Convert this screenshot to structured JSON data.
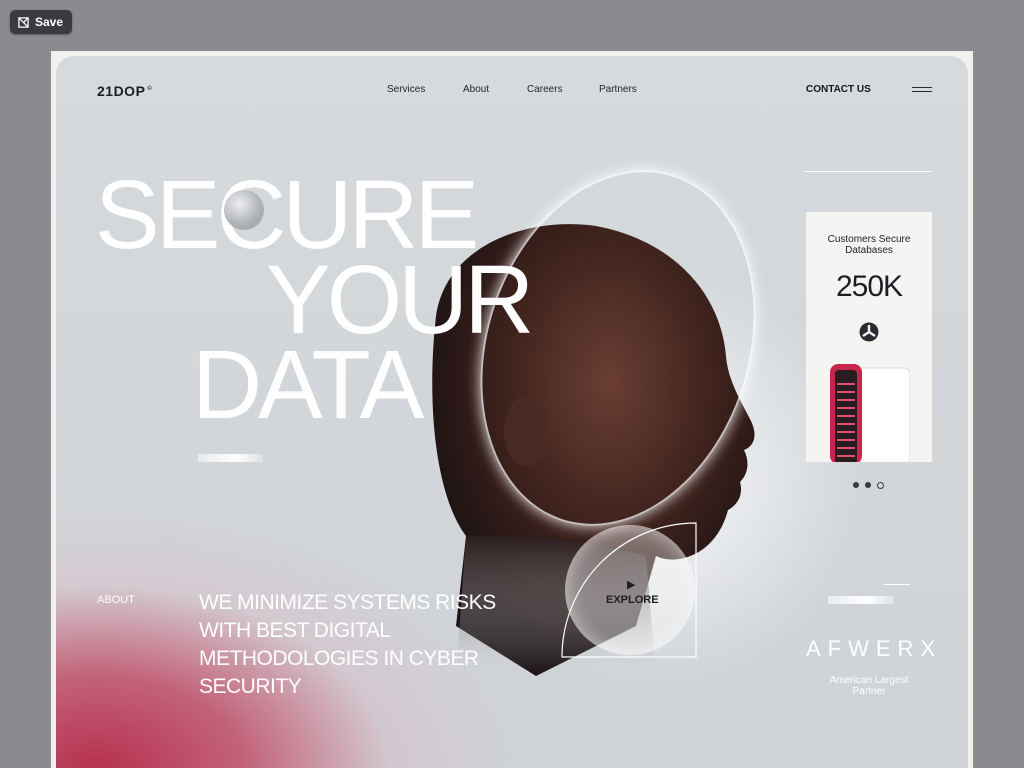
{
  "toolbar": {
    "save_label": "Save"
  },
  "header": {
    "logo": "21DOP",
    "logo_mark": "©",
    "nav": [
      "Services",
      "About",
      "Careers",
      "Partners"
    ],
    "contact": "CONTACT US"
  },
  "hero": {
    "title_lines": [
      "SECURE",
      "YOUR",
      "DATA"
    ],
    "about_label": "ABOUT",
    "tagline": "WE MINIMIZE SYSTEMS RISKS WITH BEST DIGITAL METHODOLOGIES IN CYBER SECURITY",
    "explore": "EXPLORE"
  },
  "stat_card": {
    "label": "Customers Secure Databases",
    "value": "250K"
  },
  "carousel": {
    "active_index": 1,
    "count": 3
  },
  "partner": {
    "logo": "AFWERX",
    "caption": "American Largest Partner"
  },
  "colors": {
    "accent": "#b7314f",
    "text_dark": "#1d1e22",
    "background": "#d6dadd"
  }
}
